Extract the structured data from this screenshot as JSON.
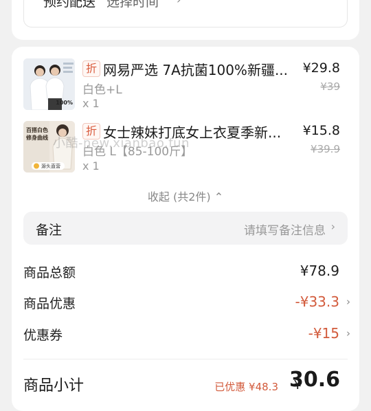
{
  "schedule": {
    "label": "预约配送",
    "value": "选择时间",
    "chevron": "›"
  },
  "products": [
    {
      "tag": "折",
      "title": "网易严选 7A抗菌100%新疆...",
      "spec": "白色+L",
      "qty": "x 1",
      "price": "¥29.8",
      "original_price": "¥39",
      "thumb_caption": "100%"
    },
    {
      "tag": "折",
      "title": "女士辣妹打底女上衣夏季新...",
      "spec": "白色 L【85-100斤】",
      "qty": "x 1",
      "price": "¥15.8",
      "original_price": "¥39.9",
      "thumb_caption": "百搭白色 修身曲线",
      "thumb_badge": "源头直营"
    }
  ],
  "watermark": "小酷-new.xianbao.fun",
  "collapse": {
    "label": "收起 (共2件)",
    "chevron": "⌃"
  },
  "note": {
    "label": "备注",
    "placeholder": "请填写备注信息",
    "chevron": "›"
  },
  "summary": {
    "goods_total_label": "商品总额",
    "goods_total_value": "¥78.9",
    "goods_discount_label": "商品优惠",
    "goods_discount_value": "-¥33.3",
    "coupon_label": "优惠券",
    "coupon_value": "-¥15",
    "chevron": "›"
  },
  "subtotal": {
    "label": "商品小计",
    "saved": "已优惠 ¥48.3",
    "currency": "¥",
    "value": "30.6"
  },
  "colors": {
    "accent_red": "#d25a3b",
    "tag_border": "#f1c7bd",
    "bg": "#f1f1f1"
  }
}
